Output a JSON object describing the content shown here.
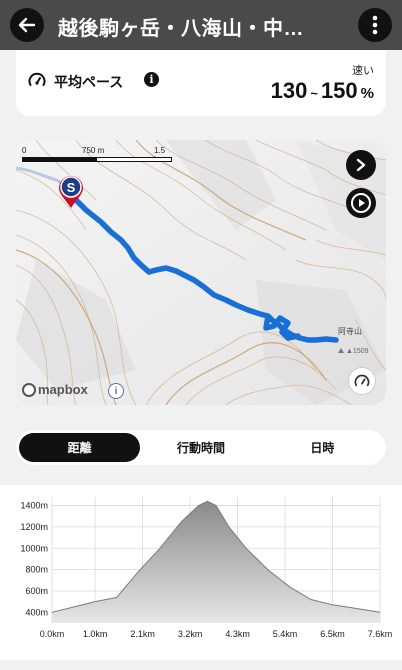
{
  "header": {
    "title": "越後駒ヶ岳・八海山・中…"
  },
  "pace": {
    "label": "平均ペース",
    "speed_label": "速い",
    "range_low": "130",
    "tilde": "~",
    "range_high": "150",
    "unit": "%"
  },
  "map": {
    "scale": {
      "zero": "0",
      "mid": "750 m",
      "max": "1.5 km"
    },
    "start_marker": "S",
    "peak_name": "阿寺山",
    "peak_elevation": "▲1509",
    "attribution": "mapbox",
    "info": "i"
  },
  "tabs": [
    {
      "label": "距離",
      "active": true
    },
    {
      "label": "行動時間",
      "active": false
    },
    {
      "label": "日時",
      "active": false
    }
  ],
  "chart_data": {
    "type": "area",
    "title": "",
    "xlabel": "",
    "ylabel": "",
    "x_ticks": [
      "0.0km",
      "1.0km",
      "2.1km",
      "3.2km",
      "4.3km",
      "5.4km",
      "6.5km",
      "7.6km"
    ],
    "y_ticks": [
      "400m",
      "600m",
      "800m",
      "1000m",
      "1200m",
      "1400m"
    ],
    "xlim": [
      0,
      7.6
    ],
    "ylim": [
      300,
      1480
    ],
    "grid": true,
    "series": [
      {
        "x": [
          0.0,
          0.5,
          1.0,
          1.5,
          2.0,
          2.5,
          3.0,
          3.4,
          3.6,
          3.8,
          4.1,
          4.5,
          5.0,
          5.5,
          6.0,
          6.5,
          7.0,
          7.6
        ],
        "y": [
          400,
          450,
          500,
          540,
          780,
          1000,
          1250,
          1400,
          1440,
          1400,
          1200,
          1000,
          800,
          640,
          520,
          470,
          440,
          400
        ]
      }
    ],
    "colors": {
      "fill_top": "#8a8a8a",
      "fill_bottom": "#e6e6e6",
      "line": "#7a7a7a"
    }
  }
}
